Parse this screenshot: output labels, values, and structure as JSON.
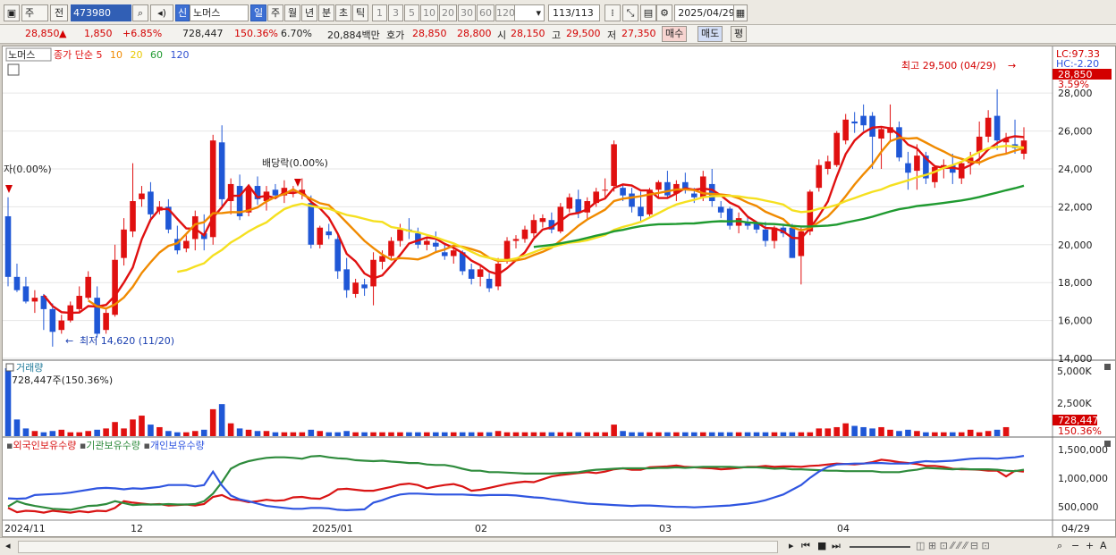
{
  "toolbar": {
    "market": "주",
    "period_type": "전",
    "stock_code": "473980",
    "stock_badge": "신",
    "stock_name": "노머스",
    "periods": [
      "일",
      "주",
      "월",
      "년",
      "분",
      "초",
      "틱"
    ],
    "active_period": "일",
    "intervals": [
      "1",
      "3",
      "5",
      "10",
      "20",
      "30",
      "60",
      "120"
    ],
    "count": "113",
    "total": "/113",
    "date": "2025/04/29"
  },
  "quote": {
    "price": "28,850",
    "change": "1,850",
    "change_pct": "+6.85%",
    "volume": "728,447",
    "volume_ratio": "150.36%",
    "turnover": "6.70%",
    "amount": "20,884백만",
    "bid_label": "호가",
    "ask": "28,850",
    "bid": "28,800",
    "open_label": "시",
    "open": "28,150",
    "high_label": "고",
    "high": "29,500",
    "low_label": "저",
    "low": "27,350",
    "buy_label": "매수",
    "sell_label": "매도",
    "eval_label": "평"
  },
  "price_panel": {
    "stock_tag": "노머스",
    "ma_legend": [
      "종가 단순 5",
      "10",
      "20",
      "60",
      "120"
    ],
    "ma_colors": [
      "#e01010",
      "#f08a00",
      "#f5e020",
      "#1f9a30",
      "#3050d0"
    ],
    "high_note": "최고 29,500 (04/29)",
    "low_note": "최저 14,620 (11/20)",
    "dividend_note_1": "배당락(0.00%)",
    "dividend_note_2": "자(0.00%)",
    "lc": "LC:97.33",
    "hc": "HC:-2.20",
    "last_price": "28,850",
    "last_pct": "3.59%",
    "y_ticks": [
      "28,000",
      "26,000",
      "24,000",
      "22,000",
      "20,000",
      "18,000",
      "16,000",
      "14,000"
    ]
  },
  "volume_panel": {
    "title": "거래량",
    "info": "728,447주(150.36%)",
    "y_ticks": [
      "5,000K",
      "2,500K"
    ],
    "last": "728,447",
    "last_pct": "150.36%"
  },
  "holding_panel": {
    "legend": [
      "외국인보유수량",
      "기관보유수량",
      "개인보유수량"
    ],
    "colors": [
      "#d91414",
      "#2e8b3c",
      "#2f55e0"
    ],
    "y_ticks": [
      "1,500,000",
      "1,000,000",
      "500,000"
    ]
  },
  "x_axis": {
    "labels": [
      "2024/11",
      "12",
      "2025/01",
      "02",
      "03",
      "04"
    ],
    "last": "04/29"
  },
  "chart_data": {
    "type": "candlestick",
    "ylim": [
      14000,
      29800
    ],
    "candles": [
      [
        21500,
        22500,
        17800,
        18300
      ],
      [
        18300,
        19000,
        17500,
        17600
      ],
      [
        17800,
        18300,
        16900,
        17000
      ],
      [
        17000,
        17600,
        16400,
        17200
      ],
      [
        17300,
        17400,
        15500,
        16600
      ],
      [
        16600,
        16900,
        14620,
        15400
      ],
      [
        15500,
        16300,
        15300,
        16000
      ],
      [
        16000,
        17000,
        15900,
        16800
      ],
      [
        16600,
        17800,
        16400,
        17300
      ],
      [
        17200,
        18600,
        17100,
        18300
      ],
      [
        17200,
        17800,
        15100,
        15300
      ],
      [
        15500,
        16600,
        15300,
        16400
      ],
      [
        16300,
        20000,
        16200,
        19200
      ],
      [
        19300,
        21400,
        18900,
        20800
      ],
      [
        20700,
        24300,
        20400,
        22300
      ],
      [
        22400,
        23100,
        22000,
        22700
      ],
      [
        22800,
        23300,
        21200,
        21600
      ],
      [
        21800,
        22300,
        21600,
        22000
      ],
      [
        22000,
        22400,
        20600,
        20800
      ],
      [
        20300,
        21000,
        19500,
        19700
      ],
      [
        19800,
        20500,
        19600,
        20200
      ],
      [
        20300,
        21800,
        19700,
        21500
      ],
      [
        20600,
        21600,
        19700,
        20300
      ],
      [
        20400,
        25800,
        20000,
        25500
      ],
      [
        25400,
        26300,
        22000,
        22400
      ],
      [
        22300,
        23500,
        21600,
        23200
      ],
      [
        23100,
        23700,
        21300,
        21500
      ],
      [
        21700,
        23200,
        21500,
        23000
      ],
      [
        23100,
        23600,
        22100,
        22400
      ],
      [
        22300,
        23100,
        21800,
        22800
      ],
      [
        22900,
        23200,
        22400,
        22600
      ],
      [
        22600,
        23400,
        22200,
        23000
      ],
      [
        22800,
        23100,
        22500,
        22800
      ],
      [
        22700,
        23500,
        22400,
        22900
      ],
      [
        22200,
        22600,
        19800,
        20000
      ],
      [
        20000,
        21000,
        19800,
        20900
      ],
      [
        20700,
        21100,
        20300,
        20500
      ],
      [
        20300,
        20600,
        18200,
        18600
      ],
      [
        18700,
        19300,
        17200,
        17600
      ],
      [
        17400,
        18200,
        17200,
        18000
      ],
      [
        17900,
        18200,
        17300,
        17700
      ],
      [
        17800,
        19600,
        16800,
        19200
      ],
      [
        19100,
        19700,
        18700,
        19400
      ],
      [
        19400,
        20400,
        19200,
        20200
      ],
      [
        20200,
        21100,
        19900,
        20800
      ],
      [
        20800,
        21400,
        20300,
        20700
      ],
      [
        20600,
        20900,
        19800,
        20000
      ],
      [
        20000,
        20400,
        19700,
        20200
      ],
      [
        20100,
        20700,
        19600,
        19900
      ],
      [
        19600,
        20000,
        19200,
        19400
      ],
      [
        19400,
        19900,
        19000,
        19700
      ],
      [
        19600,
        19700,
        18400,
        18600
      ],
      [
        18700,
        19000,
        17900,
        18200
      ],
      [
        18300,
        18900,
        17800,
        18700
      ],
      [
        18200,
        18500,
        17500,
        17700
      ],
      [
        17800,
        19300,
        17600,
        19000
      ],
      [
        19200,
        20400,
        19000,
        20200
      ],
      [
        20200,
        20500,
        19800,
        20300
      ],
      [
        20300,
        21000,
        20100,
        20800
      ],
      [
        20600,
        21600,
        20400,
        21300
      ],
      [
        21200,
        21600,
        20900,
        21400
      ],
      [
        21300,
        21700,
        20600,
        20800
      ],
      [
        20700,
        22200,
        20600,
        22000
      ],
      [
        21900,
        22700,
        21700,
        22500
      ],
      [
        22400,
        22900,
        21400,
        21700
      ],
      [
        21700,
        22500,
        21300,
        22300
      ],
      [
        22200,
        23000,
        22000,
        22800
      ],
      [
        22900,
        23500,
        22500,
        22900
      ],
      [
        23100,
        25500,
        22800,
        25300
      ],
      [
        23000,
        23200,
        22300,
        22600
      ],
      [
        22700,
        23000,
        21700,
        22000
      ],
      [
        22000,
        22800,
        21200,
        21500
      ],
      [
        21600,
        23000,
        21500,
        22900
      ],
      [
        22900,
        23400,
        22500,
        23300
      ],
      [
        23300,
        23900,
        22500,
        22600
      ],
      [
        22700,
        23400,
        22300,
        23200
      ],
      [
        23300,
        23800,
        22700,
        22900
      ],
      [
        22700,
        23000,
        22200,
        22500
      ],
      [
        22500,
        23900,
        22300,
        23600
      ],
      [
        23200,
        24000,
        22000,
        22300
      ],
      [
        22000,
        22300,
        21400,
        21700
      ],
      [
        21900,
        22000,
        20800,
        21000
      ],
      [
        21000,
        21700,
        20600,
        21400
      ],
      [
        21200,
        21500,
        20800,
        21000
      ],
      [
        21100,
        21200,
        20600,
        20800
      ],
      [
        20800,
        21200,
        19900,
        20200
      ],
      [
        20200,
        21000,
        19800,
        20900
      ],
      [
        20900,
        21100,
        20400,
        20600
      ],
      [
        20900,
        21100,
        19300,
        19300
      ],
      [
        19400,
        20900,
        17900,
        20700
      ],
      [
        20700,
        22900,
        20500,
        22800
      ],
      [
        23000,
        24500,
        22800,
        24200
      ],
      [
        24000,
        24700,
        23700,
        24400
      ],
      [
        24200,
        26000,
        24100,
        25900
      ],
      [
        25500,
        26900,
        25300,
        26600
      ],
      [
        26500,
        27000,
        25900,
        26400
      ],
      [
        26800,
        27400,
        26000,
        26300
      ],
      [
        26800,
        27000,
        24000,
        25700
      ],
      [
        25600,
        26200,
        24000,
        26100
      ],
      [
        25900,
        27400,
        25400,
        26200
      ],
      [
        26200,
        26500,
        24400,
        24600
      ],
      [
        24300,
        24900,
        22900,
        23800
      ],
      [
        23900,
        25300,
        22900,
        24700
      ],
      [
        24700,
        24900,
        23200,
        23500
      ],
      [
        23300,
        24200,
        23000,
        24100
      ],
      [
        24100,
        24500,
        23500,
        24200
      ],
      [
        24200,
        24800,
        23200,
        23800
      ],
      [
        23500,
        24400,
        23200,
        24300
      ],
      [
        24300,
        24900,
        23700,
        24600
      ],
      [
        24900,
        26500,
        24200,
        25700
      ],
      [
        25700,
        27100,
        25400,
        26700
      ],
      [
        26800,
        28200,
        25000,
        25500
      ],
      [
        25400,
        25900,
        24800,
        25600
      ],
      [
        25300,
        26600,
        24800,
        25100
      ],
      [
        24800,
        26200,
        24500,
        25500
      ]
    ],
    "volume_k": [
      5300,
      1300,
      600,
      400,
      300,
      400,
      500,
      300,
      300,
      400,
      500,
      600,
      1100,
      600,
      1300,
      1600,
      900,
      700,
      400,
      300,
      300,
      400,
      500,
      2100,
      2500,
      1000,
      600,
      500,
      400,
      400,
      300,
      300,
      300,
      300,
      500,
      400,
      300,
      300,
      400,
      300,
      300,
      300,
      300,
      300,
      300,
      300,
      300,
      300,
      300,
      300,
      300,
      300,
      300,
      300,
      300,
      400,
      300,
      300,
      300,
      300,
      300,
      300,
      300,
      300,
      300,
      300,
      300,
      300,
      900,
      400,
      300,
      300,
      300,
      300,
      300,
      300,
      300,
      300,
      300,
      300,
      300,
      300,
      300,
      300,
      300,
      300,
      300,
      300,
      300,
      300,
      300,
      600,
      600,
      700,
      1000,
      800,
      700,
      600,
      700,
      500,
      400,
      500,
      400,
      300,
      300,
      300,
      300,
      300,
      500,
      300,
      400,
      500,
      700
    ],
    "volume_ylim": [
      0,
      5300
    ],
    "holding_ylim": [
      200000,
      1700000
    ],
    "foreign_holding": [
      420000,
      330000,
      360000,
      350000,
      320000,
      360000,
      340000,
      320000,
      350000,
      330000,
      360000,
      350000,
      420000,
      560000,
      530000,
      510000,
      490000,
      500000,
      470000,
      480000,
      490000,
      470000,
      500000,
      650000,
      690000,
      600000,
      580000,
      540000,
      560000,
      590000,
      570000,
      580000,
      640000,
      650000,
      620000,
      610000,
      690000,
      810000,
      820000,
      800000,
      780000,
      780000,
      820000,
      860000,
      910000,
      930000,
      900000,
      830000,
      870000,
      900000,
      920000,
      870000,
      780000,
      800000,
      840000,
      880000,
      920000,
      950000,
      970000,
      960000,
      1020000,
      1080000,
      1110000,
      1130000,
      1150000,
      1170000,
      1150000,
      1180000,
      1230000,
      1250000,
      1220000,
      1220000,
      1270000,
      1280000,
      1290000,
      1310000,
      1280000,
      1270000,
      1260000,
      1250000,
      1230000,
      1240000,
      1260000,
      1280000,
      1280000,
      1300000,
      1280000,
      1290000,
      1290000,
      1280000,
      1300000,
      1310000,
      1330000,
      1350000,
      1340000,
      1330000,
      1350000,
      1380000,
      1430000,
      1410000,
      1380000,
      1360000,
      1340000,
      1300000,
      1300000,
      1280000,
      1240000,
      1230000,
      1230000,
      1220000,
      1200000,
      1200000,
      1080000,
      1200000,
      1180000
    ],
    "institution_holding": [
      450000,
      560000,
      500000,
      460000,
      430000,
      400000,
      390000,
      380000,
      420000,
      460000,
      470000,
      500000,
      560000,
      520000,
      480000,
      490000,
      490000,
      490000,
      500000,
      490000,
      490000,
      500000,
      560000,
      720000,
      960000,
      1240000,
      1340000,
      1400000,
      1440000,
      1470000,
      1480000,
      1480000,
      1470000,
      1450000,
      1500000,
      1510000,
      1480000,
      1460000,
      1450000,
      1420000,
      1410000,
      1400000,
      1410000,
      1390000,
      1380000,
      1360000,
      1360000,
      1330000,
      1320000,
      1320000,
      1290000,
      1240000,
      1200000,
      1200000,
      1170000,
      1170000,
      1160000,
      1150000,
      1140000,
      1140000,
      1140000,
      1140000,
      1150000,
      1160000,
      1170000,
      1200000,
      1220000,
      1230000,
      1240000,
      1250000,
      1250000,
      1250000,
      1250000,
      1260000,
      1260000,
      1270000,
      1260000,
      1270000,
      1280000,
      1280000,
      1280000,
      1280000,
      1270000,
      1270000,
      1270000,
      1260000,
      1240000,
      1250000,
      1230000,
      1230000,
      1220000,
      1210000,
      1200000,
      1200000,
      1190000,
      1190000,
      1190000,
      1190000,
      1170000,
      1170000,
      1170000,
      1200000,
      1220000,
      1260000,
      1250000,
      1240000,
      1230000,
      1240000,
      1230000,
      1230000,
      1230000,
      1220000,
      1200000,
      1190000,
      1220000
    ],
    "individual_holding": [
      620000,
      610000,
      620000,
      690000,
      700000,
      710000,
      720000,
      740000,
      770000,
      800000,
      830000,
      840000,
      830000,
      810000,
      830000,
      820000,
      840000,
      860000,
      900000,
      900000,
      900000,
      870000,
      900000,
      1180000,
      890000,
      680000,
      600000,
      560000,
      510000,
      460000,
      440000,
      420000,
      400000,
      400000,
      420000,
      420000,
      410000,
      380000,
      370000,
      380000,
      390000,
      530000,
      580000,
      650000,
      700000,
      720000,
      720000,
      710000,
      700000,
      700000,
      700000,
      700000,
      690000,
      680000,
      690000,
      690000,
      690000,
      680000,
      660000,
      640000,
      630000,
      600000,
      580000,
      550000,
      530000,
      510000,
      500000,
      490000,
      480000,
      470000,
      460000,
      470000,
      470000,
      460000,
      450000,
      440000,
      440000,
      430000,
      440000,
      450000,
      460000,
      470000,
      490000,
      510000,
      540000,
      580000,
      640000,
      700000,
      800000,
      900000,
      1050000,
      1180000,
      1280000,
      1330000,
      1340000,
      1350000,
      1350000,
      1360000,
      1360000,
      1350000,
      1350000,
      1350000,
      1380000,
      1400000,
      1390000,
      1400000,
      1410000,
      1430000,
      1450000,
      1460000,
      1460000,
      1450000,
      1470000,
      1480000,
      1510000
    ]
  }
}
